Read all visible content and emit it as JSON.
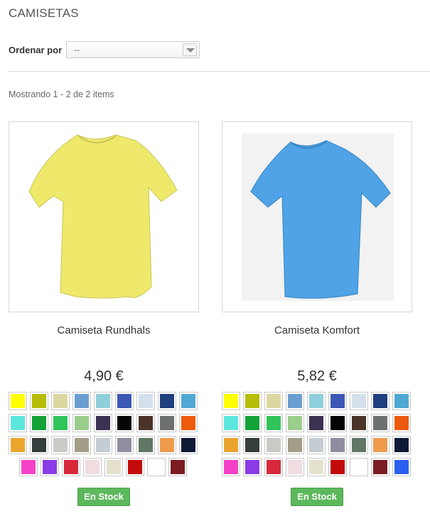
{
  "page": {
    "title": "CAMISETAS"
  },
  "sort": {
    "label": "Ordenar por",
    "value": "--"
  },
  "listing": {
    "count_text": "Mostrando 1 - 2 de 2 items"
  },
  "products": [
    {
      "name": "Camiseta Rundhals",
      "price": "4,90 €",
      "shirt_color": "#eee96a",
      "stock_label": "En Stock",
      "swatches": [
        [
          "#ffff00",
          "#b5bd05",
          "#dcd7a0",
          "#6b9ed0",
          "#8fcfdc",
          "#3c58b6",
          "#d3dfea",
          "#1f3f7f",
          "#4fa9d4"
        ],
        [
          "#5ce7de",
          "#12a238",
          "#2fc55a",
          "#9bcd8c",
          "#3d3152",
          "#050505",
          "#4a3428",
          "#6c7070",
          "#ee5a0d"
        ],
        [
          "#eba52d",
          "#353e3d",
          "#cbcac6",
          "#a39e88",
          "#c5cdd3",
          "#8f8ea0",
          "#617766",
          "#ef9a4c",
          "#0e1a36"
        ],
        [
          "#f442c8",
          "#8a3ce6",
          "#d7283c",
          "#f1dde0",
          "#e4e1cd",
          "#c40b0b",
          "#ffffff",
          "#7b1d22"
        ]
      ]
    },
    {
      "name": "Camiseta Komfort",
      "price": "5,82 €",
      "shirt_color": "#4fa3e6",
      "stock_label": "En Stock",
      "swatches": [
        [
          "#ffff00",
          "#b5bd05",
          "#dcd7a0",
          "#6b9ed0",
          "#8fcfdc",
          "#3c58b6",
          "#d3dfea",
          "#1f3f7f",
          "#4fa9d4"
        ],
        [
          "#5ce7de",
          "#12a238",
          "#2fc55a",
          "#9bcd8c",
          "#3d3152",
          "#050505",
          "#4a3428",
          "#6c7070",
          "#ee5a0d"
        ],
        [
          "#eba52d",
          "#353e3d",
          "#cbcac6",
          "#a39e88",
          "#c5cdd3",
          "#8f8ea0",
          "#617766",
          "#ef9a4c",
          "#0e1a36"
        ],
        [
          "#f442c8",
          "#8a3ce6",
          "#d7283c",
          "#f1dde0",
          "#e4e1cd",
          "#c40b0b",
          "#ffffff",
          "#7b1d22",
          "#2a5ff0"
        ]
      ]
    }
  ]
}
